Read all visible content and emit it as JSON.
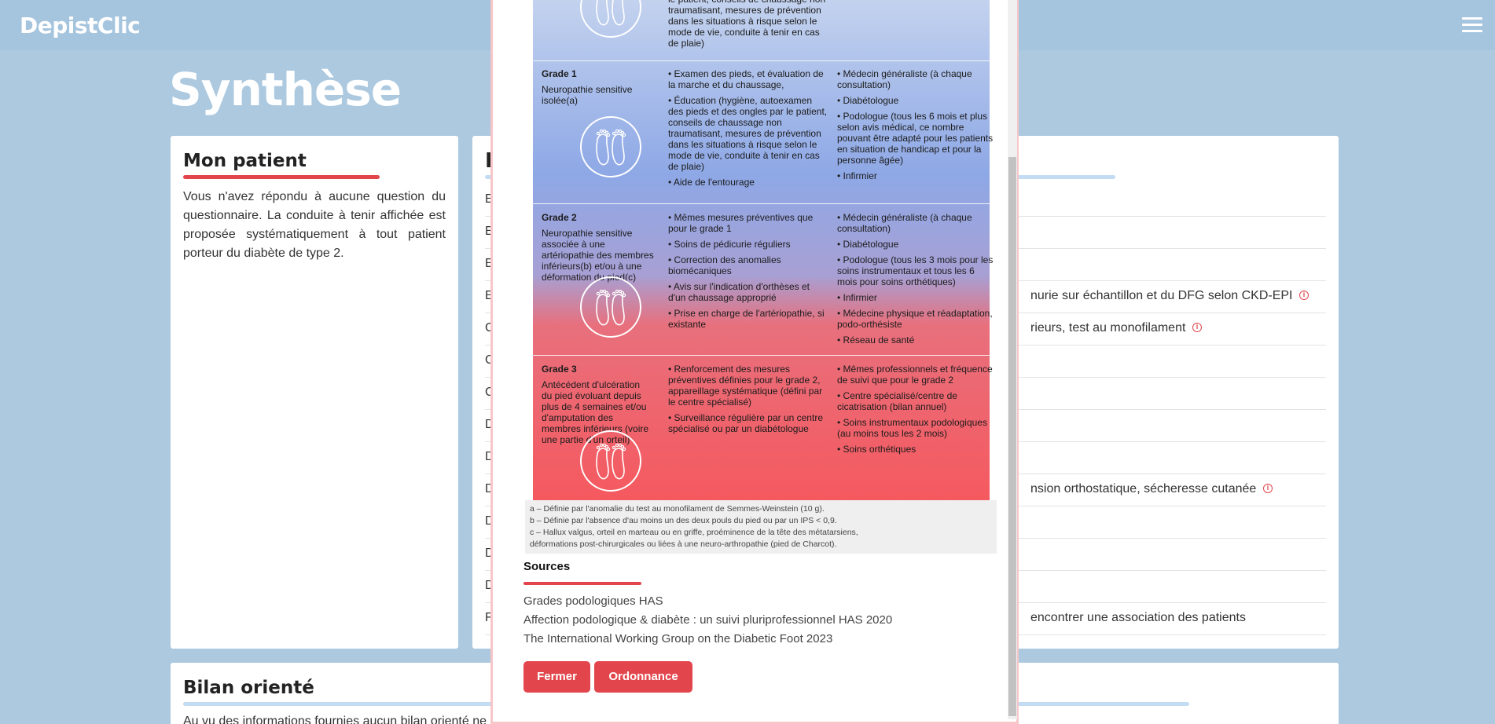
{
  "navbar": {
    "brand": "DepistClic",
    "menu_icon": "hamburger-icon"
  },
  "page": {
    "title": "Synthèse"
  },
  "patient_card": {
    "title": "Mon patient",
    "text": "Vous n'avez répondu à aucune question du questionnaire. La conduite à tenir affichée est proposée systématiquement à tout patient porteur du diabète de type 2."
  },
  "bilan_card": {
    "heading_letter": "B",
    "rows": [
      {
        "letter": "E",
        "text": "",
        "info": false
      },
      {
        "letter": "E",
        "text": "",
        "info": false
      },
      {
        "letter": "E",
        "text": "",
        "info": false
      },
      {
        "letter": "E",
        "text": "nurie sur échantillon et du DFG selon CKD-EPI",
        "info": true
      },
      {
        "letter": "C",
        "text": "rieurs, test au monofilament",
        "info": true
      },
      {
        "letter": "C",
        "text": "",
        "info": false
      },
      {
        "letter": "C",
        "text": "",
        "info": false
      },
      {
        "letter": "D",
        "text": "",
        "info": false
      },
      {
        "letter": "D",
        "text": "",
        "info": false
      },
      {
        "letter": "D",
        "text": "nsion orthostatique, sécheresse cutanée",
        "info": true
      },
      {
        "letter": "D",
        "text": "",
        "info": false
      },
      {
        "letter": "D",
        "text": "",
        "info": false
      },
      {
        "letter": "D",
        "text": "",
        "info": false
      },
      {
        "letter": "F",
        "text": "encontrer une association des patients",
        "info": false
      }
    ]
  },
  "oriente_card": {
    "title": "Bilan orienté",
    "text": "Au vu des informations fournies aucun bilan orienté ne"
  },
  "modal": {
    "grades": [
      {
        "title": "",
        "desc": "",
        "actions": [
          "le patient, conseils de chaussage non traumatisant, mesures de prévention dans les situations à risque selon le mode de vie, conduite à tenir en cas de plaie)"
        ],
        "actors": []
      },
      {
        "title": "Grade 1",
        "desc": "Neuropathie sensitive isolée(a)",
        "actions": [
          "Examen des pieds, et évaluation de la marche et du chaussage,",
          "Éducation (hygiène, autoexamen des pieds et des ongles par le patient, conseils de chaussage non traumatisant, mesures de prévention dans les situations à risque selon le mode de vie, conduite à tenir en cas de plaie)",
          "Aide de l'entourage"
        ],
        "actors": [
          "Médecin généraliste (à chaque consultation)",
          "Diabétologue",
          "Podologue (tous les 6 mois et plus selon avis médical, ce nombre pouvant être adapté pour les patients en situation de handicap et pour la personne âgée)",
          "Infirmier"
        ]
      },
      {
        "title": "Grade 2",
        "desc": "Neuropathie sensitive associée à une artériopathie des membres inférieurs(b) et/ou à une déformation du pied(c)",
        "actions": [
          "Mêmes mesures préventives que pour le grade 1",
          "Soins de pédicurie réguliers",
          "Correction des anomalies biomécaniques",
          "Avis sur l'indication d'orthèses et d'un chaussage approprié",
          "Prise en charge de l'artériopathie, si existante"
        ],
        "actors": [
          "Médecin généraliste (à chaque consultation)",
          "Diabétologue",
          "Podologue (tous les 3 mois pour les soins instrumentaux et tous les 6 mois pour soins orthétiques)",
          "Infirmier",
          "Médecine physique et réadaptation, podo-orthésiste",
          "Réseau de santé"
        ]
      },
      {
        "title": "Grade 3",
        "desc": "Antécédent d'ulcération du pied évoluant depuis plus de 4 semaines et/ou d'amputation des membres inférieurs (voire une partie d'un orteil)",
        "actions": [
          "Renforcement des mesures préventives définies pour le grade 2, appareillage systématique (défini par le centre spécialisé)",
          "Surveillance régulière par un centre spécialisé ou par un diabétologue"
        ],
        "actors": [
          "Mêmes professionnels et fréquence de suivi que pour le grade 2",
          "Centre spécialisé/centre de cicatrisation (bilan annuel)",
          "Soins instrumentaux podologiques (au moins tous les 2 mois)",
          "Soins orthétiques"
        ]
      }
    ],
    "footnotes": [
      "a – Définie par l'anomalie du test au monofilament de Semmes-Weinstein (10 g).",
      "b – Définie par l'absence d'au moins un des deux pouls du pied ou par un IPS < 0,9.",
      "c – Hallux valgus, orteil en marteau ou en griffe, proéminence de la tête des métatarsiens,",
      "déformations post-chirurgicales ou liées à une neuro-arthropathie (pied de Charcot)."
    ],
    "sources_title": "Sources",
    "sources": [
      "Grades podologiques HAS",
      "Affection podologique & diabète : un suivi pluriprofessionnel HAS 2020",
      "The International Working Group on the Diabetic Foot 2023"
    ],
    "buttons": {
      "close": "Fermer",
      "prescription": "Ordonnance"
    }
  }
}
